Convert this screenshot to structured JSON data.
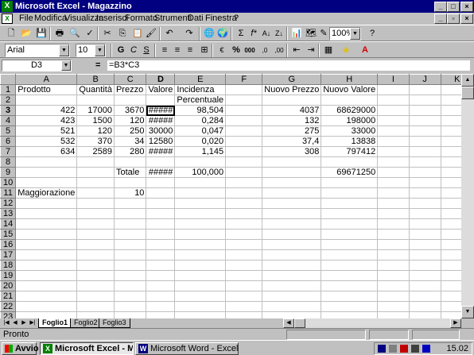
{
  "app": {
    "title": "Microsoft Excel - Magazzino",
    "icon": "excel-icon"
  },
  "menu": [
    "File",
    "Modifica",
    "Visualizza",
    "Inserisci",
    "Formato",
    "Strumenti",
    "Dati",
    "Finestra",
    "?"
  ],
  "toolbar": {
    "zoom": "100%",
    "font_name": "Arial",
    "font_size": "10",
    "bold": "G",
    "italic": "C",
    "underline": "S",
    "autosum": "Σ",
    "fx": "f*",
    "percent": "%",
    "thousands": "000"
  },
  "formula_bar": {
    "name_box": "D3",
    "equals": "=",
    "formula": "=B3*C3"
  },
  "grid": {
    "columns": [
      "A",
      "B",
      "C",
      "D",
      "E",
      "F",
      "G",
      "H",
      "I",
      "J",
      "K"
    ],
    "rows": [
      [
        "Prodotto",
        "Quantità",
        "Prezzo",
        "Valore",
        "Incidenza",
        "",
        "Nuovo Prezzo",
        "Nuovo Valore",
        "",
        "",
        ""
      ],
      [
        "",
        "",
        "",
        "",
        "Percentuale",
        "",
        "",
        "",
        "",
        "",
        ""
      ],
      [
        "422",
        "17000",
        "3670",
        "#####",
        "98,504",
        "",
        "4037",
        "68629000",
        "",
        "",
        ""
      ],
      [
        "423",
        "1500",
        "120",
        "#####",
        "0,284",
        "",
        "132",
        "198000",
        "",
        "",
        ""
      ],
      [
        "521",
        "120",
        "250",
        "30000",
        "0,047",
        "",
        "275",
        "33000",
        "",
        "",
        ""
      ],
      [
        "532",
        "370",
        "34",
        "12580",
        "0,020",
        "",
        "37,4",
        "13838",
        "",
        "",
        ""
      ],
      [
        "634",
        "2589",
        "280",
        "#####",
        "1,145",
        "",
        "308",
        "797412",
        "",
        "",
        ""
      ],
      [
        "",
        "",
        "",
        "",
        "",
        "",
        "",
        "",
        "",
        "",
        ""
      ],
      [
        "",
        "",
        "Totale",
        "#####",
        "100,000",
        "",
        "",
        "69671250",
        "",
        "",
        ""
      ],
      [
        "",
        "",
        "",
        "",
        "",
        "",
        "",
        "",
        "",
        "",
        ""
      ],
      [
        "Maggiorazione",
        "",
        "10",
        "",
        "",
        "",
        "",
        "",
        "",
        "",
        ""
      ]
    ],
    "total_rows": 24,
    "active_cell": "D3"
  },
  "sheets": [
    "Foglio1",
    "Foglio2",
    "Foglio3"
  ],
  "active_sheet": "Foglio1",
  "status": "Pronto",
  "taskbar": {
    "start": "Avvio",
    "tasks": [
      "Microsoft Excel - Mag...",
      "Microsoft Word - Excel"
    ],
    "clock": "15.02"
  }
}
